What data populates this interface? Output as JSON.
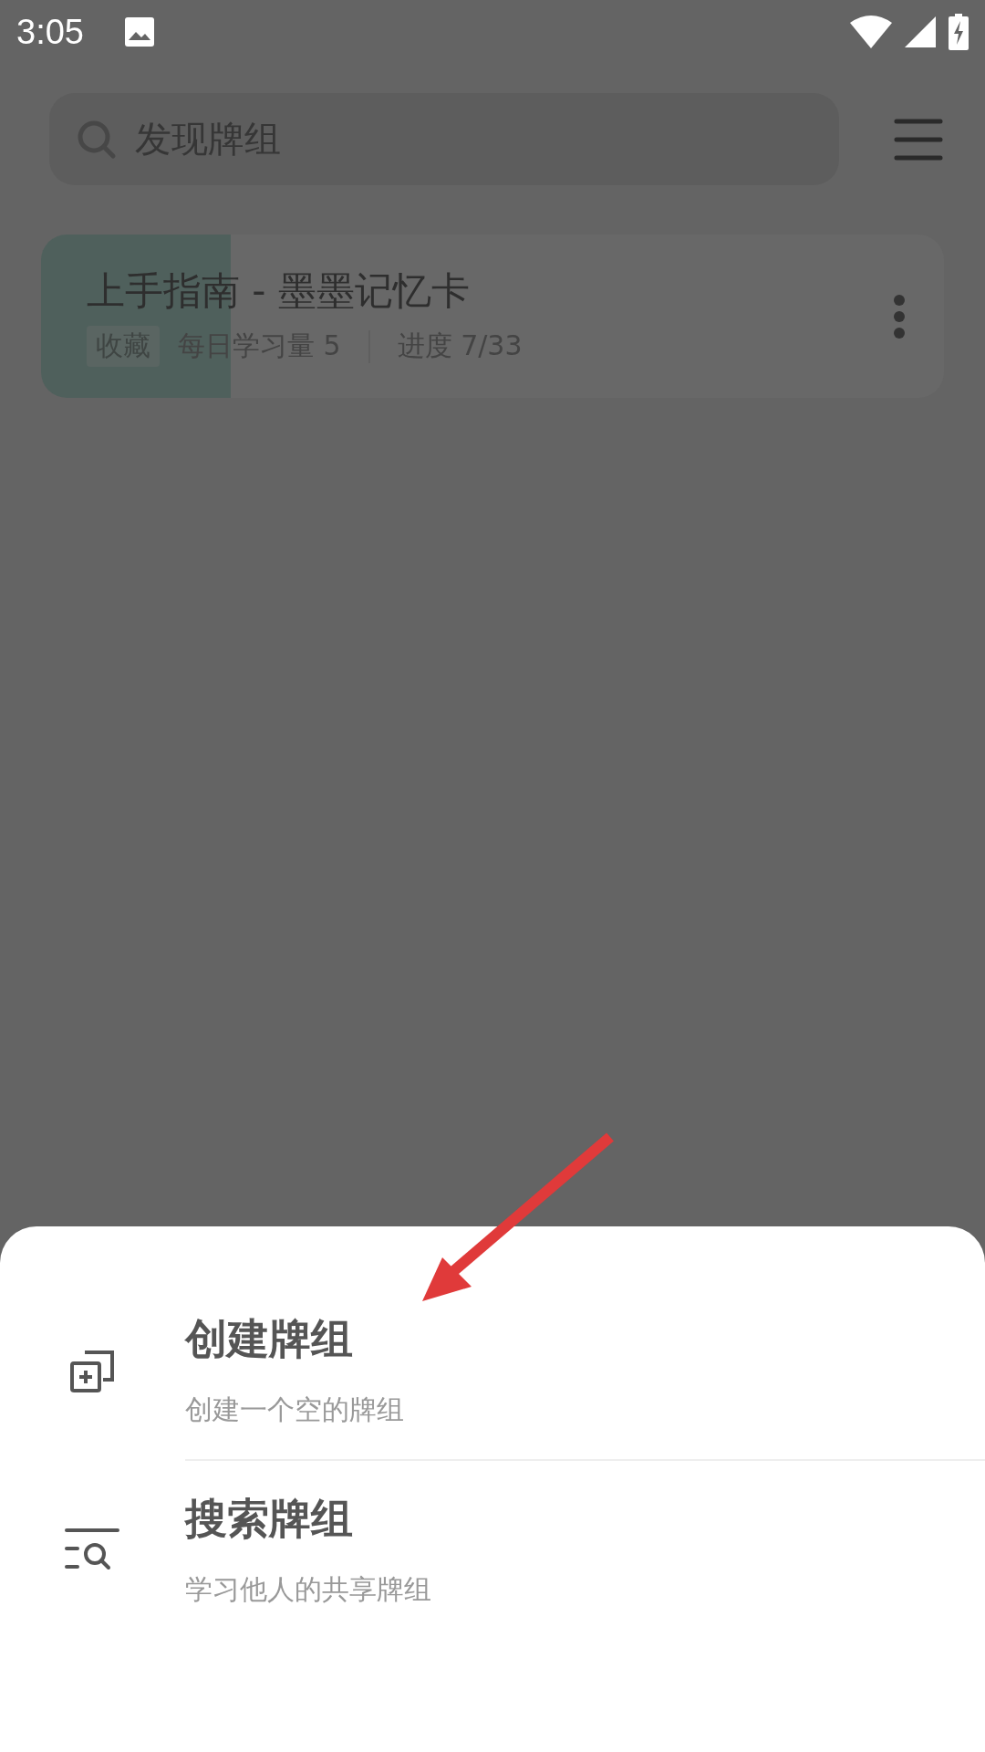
{
  "status_bar": {
    "time": "3:05"
  },
  "search": {
    "placeholder": "发现牌组"
  },
  "decks": [
    {
      "title": "上手指南 - 墨墨记忆卡",
      "tag": "收藏",
      "daily": "每日学习量 5",
      "progress": "进度 7/33",
      "level": 0.21
    }
  ],
  "sheet": {
    "items": [
      {
        "kind": "create",
        "title": "创建牌组",
        "subtitle": "创建一个空的牌组"
      },
      {
        "kind": "search",
        "title": "搜索牌组",
        "subtitle": "学习他人的共享牌组"
      }
    ]
  }
}
